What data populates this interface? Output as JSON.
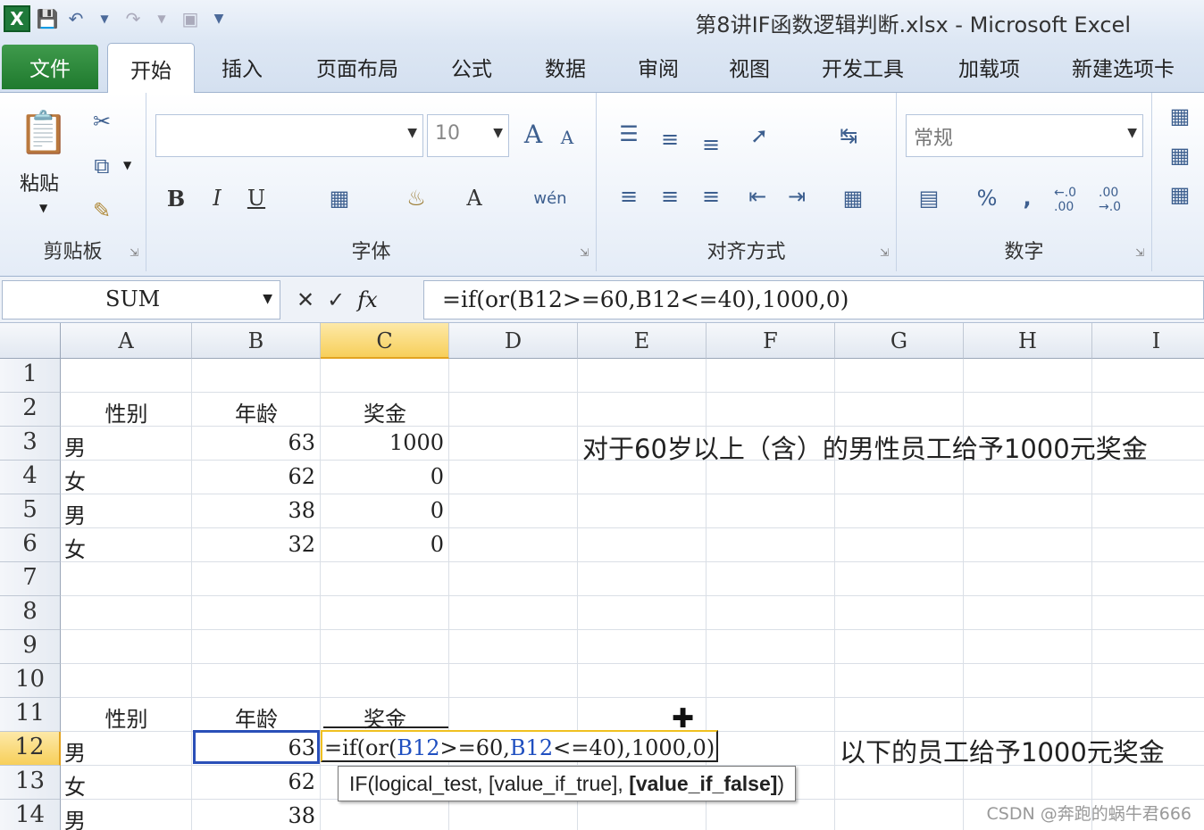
{
  "window": {
    "title": "第8讲IF函数逻辑判断.xlsx - Microsoft Excel"
  },
  "qat": {
    "logo_icon": "excel-logo-icon",
    "logo_letter": "X",
    "icons": [
      "save-icon",
      "undo-icon",
      "redo-icon",
      "print-preview-icon",
      "customize-icon"
    ]
  },
  "tabs": {
    "file": "文件",
    "home": "开始",
    "insert": "插入",
    "page_layout": "页面布局",
    "formulas": "公式",
    "data": "数据",
    "review": "审阅",
    "view": "视图",
    "developer": "开发工具",
    "addins": "加载项",
    "new_tab": "新建选项卡"
  },
  "ribbon": {
    "clipboard": {
      "paste": "粘贴",
      "label": "剪贴板"
    },
    "font": {
      "name": "",
      "size": "10",
      "bold": "B",
      "italic": "I",
      "underline": "U",
      "grow": "A",
      "shrink": "A",
      "color": "A",
      "phonetic": "wén",
      "label": "字体"
    },
    "alignment": {
      "label": "对齐方式"
    },
    "number": {
      "format": "常规",
      "percent": "%",
      "comma": ",",
      "inc": "←.0 .00",
      "dec": ".00 →.0",
      "label": "数字"
    }
  },
  "formula_bar": {
    "name_box": "SUM",
    "cancel": "✕",
    "enter": "✓",
    "fx": "fx",
    "formula": "=if(or(B12>=60,B12<=40),1000,0)"
  },
  "columns": [
    "A",
    "B",
    "C",
    "D",
    "E",
    "F",
    "G",
    "H",
    "I"
  ],
  "rows": [
    "1",
    "2",
    "3",
    "4",
    "5",
    "6",
    "7",
    "8",
    "9",
    "10",
    "11",
    "12",
    "13",
    "14"
  ],
  "cells": {
    "A2": "性别",
    "B2": "年龄",
    "C2": "奖金",
    "A3": "男",
    "B3": "63",
    "C3": "1000",
    "A4": "女",
    "B4": "62",
    "C4": "0",
    "A5": "男",
    "B5": "38",
    "C5": "0",
    "A6": "女",
    "B6": "32",
    "C6": "0",
    "A11": "性别",
    "B11": "年龄",
    "C11": "奖金",
    "A12": "男",
    "B12": "63",
    "A13": "女",
    "B13": "62",
    "A14": "男",
    "B14": "38"
  },
  "notes": {
    "note1": "对于60岁以上（含）的男性员工给予1000元奖金",
    "note2": "以下的员工给予1000元奖金"
  },
  "edit_cell": {
    "part1": "=if(or(",
    "ref1": "B12",
    "part2": ">=60,",
    "ref2": "B12",
    "part3": "<=40),1000,0)"
  },
  "tooltip": {
    "prefix": "IF(logical_test, [value_if_true], ",
    "bold": "[value_if_false]",
    "suffix": ")"
  },
  "watermark": "CSDN @奔跑的蜗牛君666",
  "colors": {
    "excel_green": "#1f7a2e",
    "selection_orange": "#f7cf5a",
    "ref_blue": "#1f4fc0"
  }
}
